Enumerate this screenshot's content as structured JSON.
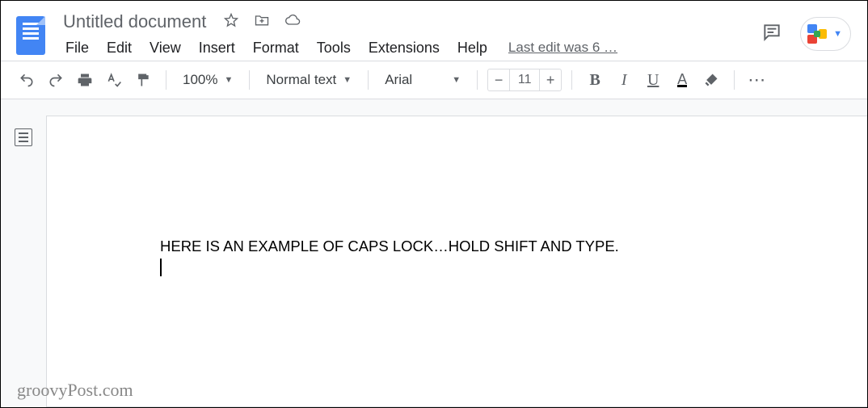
{
  "header": {
    "doc_title": "Untitled document",
    "last_edit": "Last edit was 6 …"
  },
  "menus": {
    "file": "File",
    "edit": "Edit",
    "view": "View",
    "insert": "Insert",
    "format": "Format",
    "tools": "Tools",
    "extensions": "Extensions",
    "help": "Help"
  },
  "toolbar": {
    "zoom": "100%",
    "style": "Normal text",
    "font": "Arial",
    "font_size": "11",
    "minus": "−",
    "plus": "+",
    "bold": "B",
    "italic": "I",
    "underline": "U",
    "color": "A",
    "more": "⋯"
  },
  "document": {
    "line1": "HERE IS AN EXAMPLE OF CAPS LOCK…HOLD SHIFT AND TYPE."
  },
  "watermark": "groovyPost.com"
}
